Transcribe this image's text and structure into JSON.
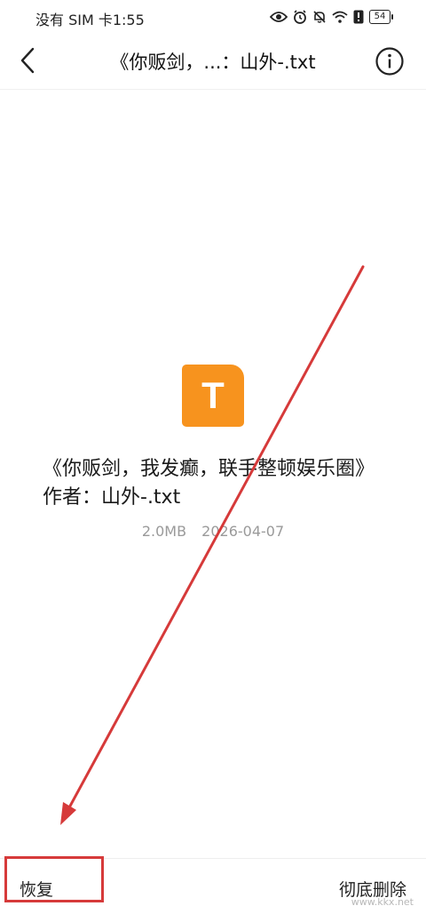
{
  "status_bar": {
    "carrier_time": "没有 SIM 卡1:55",
    "battery": "54",
    "icons": [
      "eye-icon",
      "alarm-icon",
      "mute-icon",
      "wifi-icon",
      "alert-icon",
      "battery-icon"
    ]
  },
  "header": {
    "title": "《你贩剑，...：山外-.txt",
    "back_icon": "chevron-left-icon",
    "info_icon": "info-icon"
  },
  "file": {
    "icon_letter": "T",
    "icon_color": "#f7931e",
    "name": "《你贩剑，我发癫，联手整顿娱乐圈》作者：山外-.txt",
    "size": "2.0MB",
    "date": "2026-04-07"
  },
  "bottom_bar": {
    "restore_label": "恢复",
    "delete_label": "彻底删除"
  },
  "annotation": {
    "highlight_color": "#d63a3a"
  },
  "watermark": "www.kkx.net"
}
